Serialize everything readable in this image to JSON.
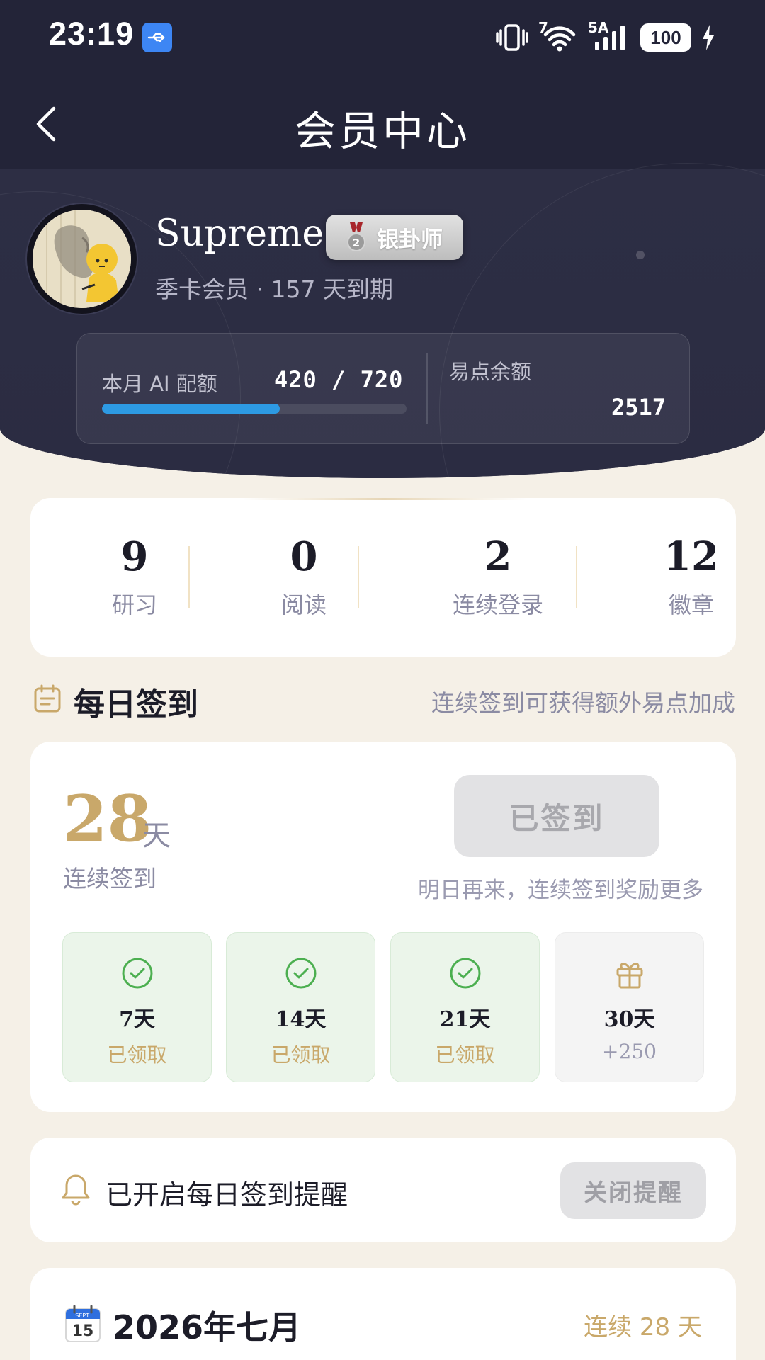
{
  "status_bar": {
    "time": "23:19",
    "network_label": "5A",
    "wifi_label": "7",
    "battery": "100"
  },
  "nav": {
    "title": "会员中心"
  },
  "user": {
    "name": "Supreme",
    "badge": "银卦师",
    "membership": "季卡会员 · 157 天到期"
  },
  "quota": {
    "label": "本月 AI 配额",
    "value": "420 / 720",
    "used": 420,
    "total": 720,
    "coin_label": "易点余额",
    "coin_value": "2517"
  },
  "stats": [
    {
      "value": "9",
      "label": "研习"
    },
    {
      "value": "0",
      "label": "阅读"
    },
    {
      "value": "2",
      "label": "连续登录"
    },
    {
      "value": "12",
      "label": "徽章"
    }
  ],
  "checkin": {
    "title": "每日签到",
    "hint": "连续签到可获得额外易点加成",
    "streak_value": "28",
    "streak_unit": "天",
    "streak_label": "连续签到",
    "button_label": "已签到",
    "button_hint": "明日再来，连续签到奖励更多",
    "rewards": [
      {
        "day": "7天",
        "status": "已领取",
        "claimed": true
      },
      {
        "day": "14天",
        "status": "已领取",
        "claimed": true
      },
      {
        "day": "21天",
        "status": "已领取",
        "claimed": true
      },
      {
        "day": "30天",
        "status": "+250",
        "claimed": false
      }
    ]
  },
  "reminder": {
    "text": "已开启每日签到提醒",
    "button_label": "关闭提醒"
  },
  "calendar": {
    "icon_month": "SEPT.",
    "icon_day": "15",
    "title": "2026年七月",
    "streak": "连续 28 天"
  },
  "colors": {
    "header_bg": "#232438",
    "accent_gold": "#c9a86a",
    "progress_blue": "#2d9ae3",
    "claimed_bg": "#ebf5ea",
    "check_green": "#4caf50",
    "page_bg": "#f5f0e7"
  }
}
